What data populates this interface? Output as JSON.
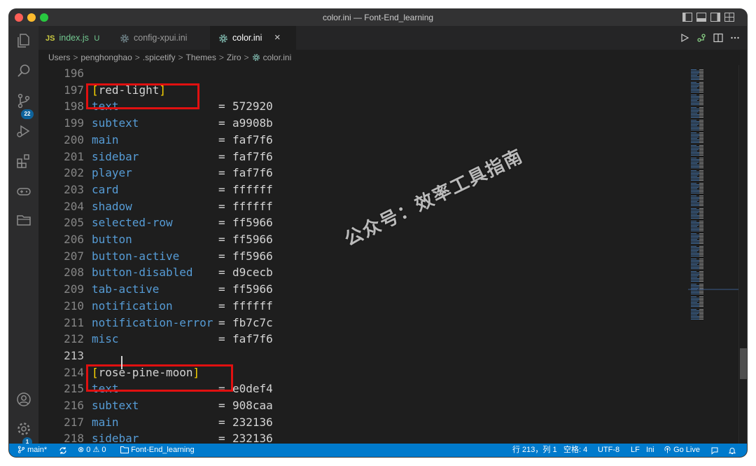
{
  "window": {
    "title": "color.ini — Font-End_learning"
  },
  "activity_bar": {
    "source_control_badge": "22",
    "settings_badge": "1"
  },
  "tabs": [
    {
      "icon": "js-file-icon",
      "icon_text": "JS",
      "label": "index.js",
      "status": "U",
      "active": false
    },
    {
      "icon": "gear-file-icon",
      "label": "config-xpui.ini",
      "active": false
    },
    {
      "icon": "gear-file-icon",
      "label": "color.ini",
      "active": true,
      "close": "×"
    }
  ],
  "breadcrumb": [
    "Users",
    "penghonghao",
    ".spicetify",
    "Themes",
    "Ziro",
    "color.ini"
  ],
  "breadcrumb_sep": ">",
  "editor": {
    "lines": [
      {
        "n": "196",
        "key": "",
        "eq": "",
        "val": "",
        "section": ""
      },
      {
        "n": "197",
        "section": "red-light"
      },
      {
        "n": "198",
        "key": "text",
        "eq": "=",
        "val": "572920"
      },
      {
        "n": "199",
        "key": "subtext",
        "eq": "=",
        "val": "a9908b"
      },
      {
        "n": "200",
        "key": "main",
        "eq": "=",
        "val": "faf7f6"
      },
      {
        "n": "201",
        "key": "sidebar",
        "eq": "=",
        "val": "faf7f6"
      },
      {
        "n": "202",
        "key": "player",
        "eq": "=",
        "val": "faf7f6"
      },
      {
        "n": "203",
        "key": "card",
        "eq": "=",
        "val": "ffffff"
      },
      {
        "n": "204",
        "key": "shadow",
        "eq": "=",
        "val": "ffffff"
      },
      {
        "n": "205",
        "key": "selected-row",
        "eq": "=",
        "val": "ff5966"
      },
      {
        "n": "206",
        "key": "button",
        "eq": "=",
        "val": "ff5966"
      },
      {
        "n": "207",
        "key": "button-active",
        "eq": "=",
        "val": "ff5966"
      },
      {
        "n": "208",
        "key": "button-disabled",
        "eq": "=",
        "val": "d9cecb"
      },
      {
        "n": "209",
        "key": "tab-active",
        "eq": "=",
        "val": "ff5966"
      },
      {
        "n": "210",
        "key": "notification",
        "eq": "=",
        "val": "ffffff"
      },
      {
        "n": "211",
        "key": "notification-error",
        "eq": "=",
        "val": "fb7c7c"
      },
      {
        "n": "212",
        "key": "misc",
        "eq": "=",
        "val": "faf7f6"
      },
      {
        "n": "213",
        "key": "",
        "eq": "",
        "val": "",
        "current": true
      },
      {
        "n": "214",
        "section": "rose-pine-moon"
      },
      {
        "n": "215",
        "key": "text",
        "eq": "=",
        "val": "e0def4"
      },
      {
        "n": "216",
        "key": "subtext",
        "eq": "=",
        "val": "908caa"
      },
      {
        "n": "217",
        "key": "main",
        "eq": "=",
        "val": "232136"
      },
      {
        "n": "218",
        "key": "sidebar",
        "eq": "=",
        "val": "232136"
      }
    ],
    "watermark": "公众号：效率工具指南"
  },
  "statusbar": {
    "branch": "main*",
    "errors": "0",
    "warnings": "0",
    "folder": "Font-End_learning",
    "position": "行 213，列 1",
    "spaces": "空格: 4",
    "encoding": "UTF-8",
    "eol": "LF",
    "language": "Ini",
    "golive": "Go Live"
  },
  "colors": {
    "accent": "#007acc",
    "highlight_box": "#e01010",
    "key": "#569cd6",
    "bracket": "#ffd700"
  }
}
